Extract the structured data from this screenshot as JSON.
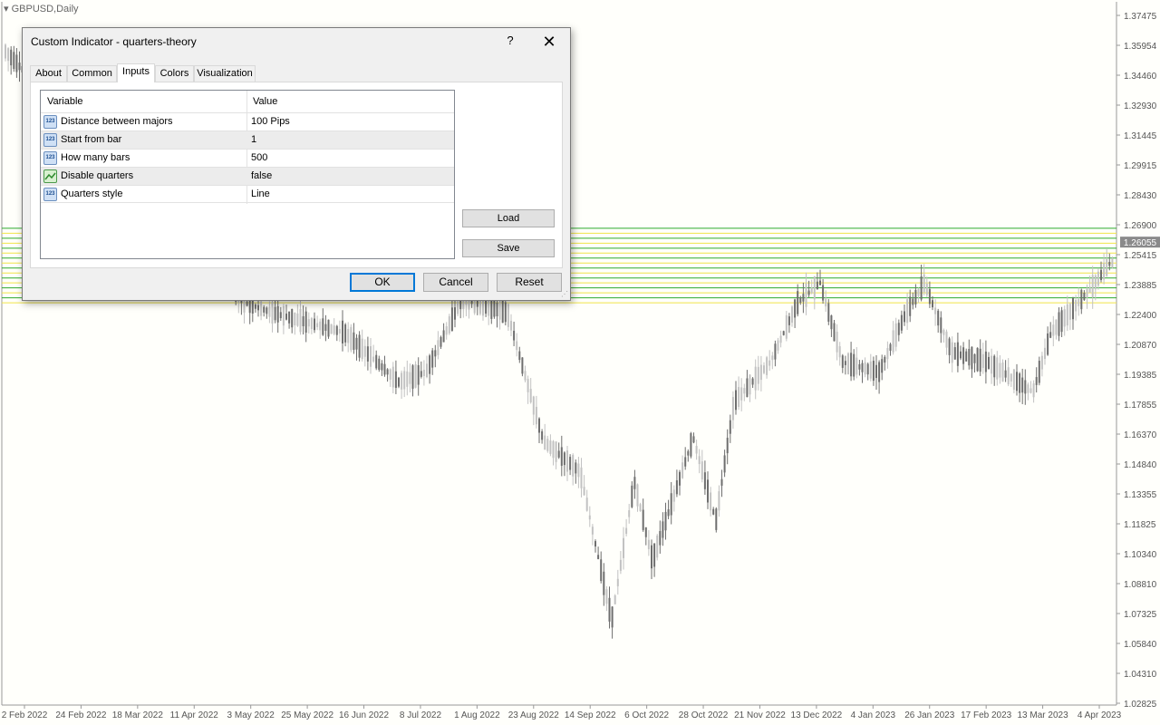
{
  "chart": {
    "symbol": "GBPUSD,Daily",
    "current_price": "1.26055",
    "price_axis": [
      "1.37475",
      "1.35954",
      "1.34460",
      "1.32930",
      "1.31445",
      "1.29915",
      "1.28430",
      "1.26900",
      "1.25415",
      "1.23885",
      "1.22400",
      "1.20870",
      "1.19385",
      "1.17855",
      "1.16370",
      "1.14840",
      "1.13355",
      "1.11825",
      "1.10340",
      "1.08810",
      "1.07325",
      "1.05840",
      "1.04310",
      "1.02825"
    ],
    "time_axis": [
      "2 Feb 2022",
      "24 Feb 2022",
      "18 Mar 2022",
      "11 Apr 2022",
      "3 May 2022",
      "25 May 2022",
      "16 Jun 2022",
      "8 Jul 2022",
      "1 Aug 2022",
      "23 Aug 2022",
      "14 Sep 2022",
      "6 Oct 2022",
      "28 Oct 2022",
      "21 Nov 2022",
      "13 Dec 2022",
      "4 Jan 2023",
      "26 Jan 2023",
      "17 Feb 2023",
      "13 Mar 2023",
      "4 Apr 2023"
    ],
    "quarter_levels": [
      1.2675,
      1.265,
      1.2625,
      1.26,
      1.2575,
      1.255,
      1.2525,
      1.25,
      1.2475,
      1.245,
      1.2425,
      1.24,
      1.2375,
      1.235,
      1.2325,
      1.23
    ],
    "colors": {
      "major": "#2eaa2e",
      "quarter": "#f0e44a",
      "bull": "#8c8c8c",
      "bear": "#8c8c8c"
    }
  },
  "dialog": {
    "title": "Custom Indicator - quarters-theory",
    "help_label": "?",
    "close_label": "✕",
    "tabs": [
      {
        "label": "About"
      },
      {
        "label": "Common"
      },
      {
        "label": "Inputs"
      },
      {
        "label": "Colors"
      },
      {
        "label": "Visualization"
      }
    ],
    "active_tab": "Inputs",
    "grid": {
      "col_variable": "Variable",
      "col_value": "Value",
      "rows": [
        {
          "icon": "numeric-input-icon",
          "variable": "Distance between majors",
          "value": "100 Pips"
        },
        {
          "icon": "numeric-input-icon",
          "variable": "Start from bar",
          "value": "1"
        },
        {
          "icon": "numeric-input-icon",
          "variable": "How many bars",
          "value": "500"
        },
        {
          "icon": "boolean-input-icon",
          "variable": "Disable quarters",
          "value": "false"
        },
        {
          "icon": "numeric-input-icon",
          "variable": "Quarters style",
          "value": "Line"
        }
      ]
    },
    "load_label": "Load",
    "save_label": "Save",
    "ok_label": "OK",
    "cancel_label": "Cancel",
    "reset_label": "Reset"
  }
}
